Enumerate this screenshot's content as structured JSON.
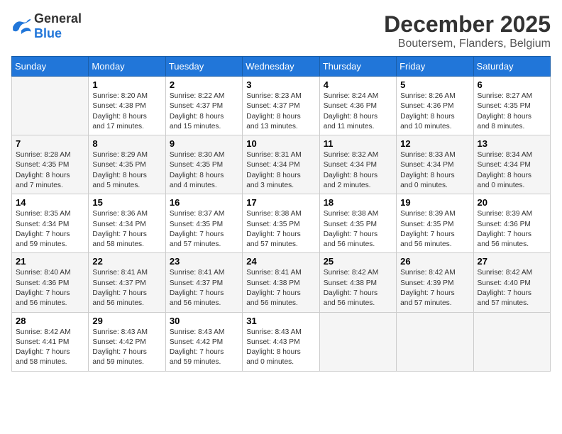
{
  "header": {
    "logo_general": "General",
    "logo_blue": "Blue",
    "month": "December 2025",
    "location": "Boutersem, Flanders, Belgium"
  },
  "days_of_week": [
    "Sunday",
    "Monday",
    "Tuesday",
    "Wednesday",
    "Thursday",
    "Friday",
    "Saturday"
  ],
  "weeks": [
    [
      {
        "day": "",
        "info": ""
      },
      {
        "day": "1",
        "info": "Sunrise: 8:20 AM\nSunset: 4:38 PM\nDaylight: 8 hours\nand 17 minutes."
      },
      {
        "day": "2",
        "info": "Sunrise: 8:22 AM\nSunset: 4:37 PM\nDaylight: 8 hours\nand 15 minutes."
      },
      {
        "day": "3",
        "info": "Sunrise: 8:23 AM\nSunset: 4:37 PM\nDaylight: 8 hours\nand 13 minutes."
      },
      {
        "day": "4",
        "info": "Sunrise: 8:24 AM\nSunset: 4:36 PM\nDaylight: 8 hours\nand 11 minutes."
      },
      {
        "day": "5",
        "info": "Sunrise: 8:26 AM\nSunset: 4:36 PM\nDaylight: 8 hours\nand 10 minutes."
      },
      {
        "day": "6",
        "info": "Sunrise: 8:27 AM\nSunset: 4:35 PM\nDaylight: 8 hours\nand 8 minutes."
      }
    ],
    [
      {
        "day": "7",
        "info": "Sunrise: 8:28 AM\nSunset: 4:35 PM\nDaylight: 8 hours\nand 7 minutes."
      },
      {
        "day": "8",
        "info": "Sunrise: 8:29 AM\nSunset: 4:35 PM\nDaylight: 8 hours\nand 5 minutes."
      },
      {
        "day": "9",
        "info": "Sunrise: 8:30 AM\nSunset: 4:35 PM\nDaylight: 8 hours\nand 4 minutes."
      },
      {
        "day": "10",
        "info": "Sunrise: 8:31 AM\nSunset: 4:34 PM\nDaylight: 8 hours\nand 3 minutes."
      },
      {
        "day": "11",
        "info": "Sunrise: 8:32 AM\nSunset: 4:34 PM\nDaylight: 8 hours\nand 2 minutes."
      },
      {
        "day": "12",
        "info": "Sunrise: 8:33 AM\nSunset: 4:34 PM\nDaylight: 8 hours\nand 0 minutes."
      },
      {
        "day": "13",
        "info": "Sunrise: 8:34 AM\nSunset: 4:34 PM\nDaylight: 8 hours\nand 0 minutes."
      }
    ],
    [
      {
        "day": "14",
        "info": "Sunrise: 8:35 AM\nSunset: 4:34 PM\nDaylight: 7 hours\nand 59 minutes."
      },
      {
        "day": "15",
        "info": "Sunrise: 8:36 AM\nSunset: 4:34 PM\nDaylight: 7 hours\nand 58 minutes."
      },
      {
        "day": "16",
        "info": "Sunrise: 8:37 AM\nSunset: 4:35 PM\nDaylight: 7 hours\nand 57 minutes."
      },
      {
        "day": "17",
        "info": "Sunrise: 8:38 AM\nSunset: 4:35 PM\nDaylight: 7 hours\nand 57 minutes."
      },
      {
        "day": "18",
        "info": "Sunrise: 8:38 AM\nSunset: 4:35 PM\nDaylight: 7 hours\nand 56 minutes."
      },
      {
        "day": "19",
        "info": "Sunrise: 8:39 AM\nSunset: 4:35 PM\nDaylight: 7 hours\nand 56 minutes."
      },
      {
        "day": "20",
        "info": "Sunrise: 8:39 AM\nSunset: 4:36 PM\nDaylight: 7 hours\nand 56 minutes."
      }
    ],
    [
      {
        "day": "21",
        "info": "Sunrise: 8:40 AM\nSunset: 4:36 PM\nDaylight: 7 hours\nand 56 minutes."
      },
      {
        "day": "22",
        "info": "Sunrise: 8:41 AM\nSunset: 4:37 PM\nDaylight: 7 hours\nand 56 minutes."
      },
      {
        "day": "23",
        "info": "Sunrise: 8:41 AM\nSunset: 4:37 PM\nDaylight: 7 hours\nand 56 minutes."
      },
      {
        "day": "24",
        "info": "Sunrise: 8:41 AM\nSunset: 4:38 PM\nDaylight: 7 hours\nand 56 minutes."
      },
      {
        "day": "25",
        "info": "Sunrise: 8:42 AM\nSunset: 4:38 PM\nDaylight: 7 hours\nand 56 minutes."
      },
      {
        "day": "26",
        "info": "Sunrise: 8:42 AM\nSunset: 4:39 PM\nDaylight: 7 hours\nand 57 minutes."
      },
      {
        "day": "27",
        "info": "Sunrise: 8:42 AM\nSunset: 4:40 PM\nDaylight: 7 hours\nand 57 minutes."
      }
    ],
    [
      {
        "day": "28",
        "info": "Sunrise: 8:42 AM\nSunset: 4:41 PM\nDaylight: 7 hours\nand 58 minutes."
      },
      {
        "day": "29",
        "info": "Sunrise: 8:43 AM\nSunset: 4:42 PM\nDaylight: 7 hours\nand 59 minutes."
      },
      {
        "day": "30",
        "info": "Sunrise: 8:43 AM\nSunset: 4:42 PM\nDaylight: 7 hours\nand 59 minutes."
      },
      {
        "day": "31",
        "info": "Sunrise: 8:43 AM\nSunset: 4:43 PM\nDaylight: 8 hours\nand 0 minutes."
      },
      {
        "day": "",
        "info": ""
      },
      {
        "day": "",
        "info": ""
      },
      {
        "day": "",
        "info": ""
      }
    ]
  ]
}
